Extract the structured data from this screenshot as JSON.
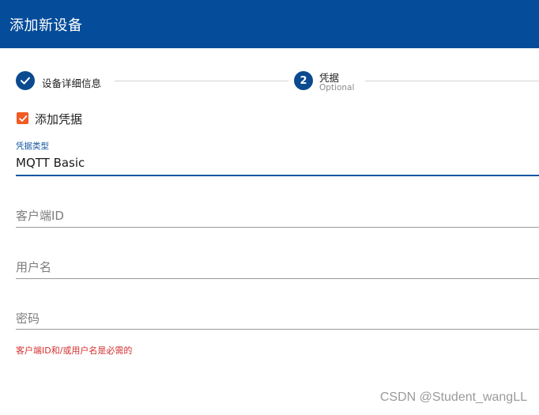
{
  "header": {
    "title": "添加新设备"
  },
  "stepper": {
    "steps": [
      {
        "label": "设备详细信息",
        "state": "completed"
      },
      {
        "number": "2",
        "label": "凭据",
        "sublabel": "Optional",
        "state": "active"
      }
    ]
  },
  "credentials": {
    "add_checkbox_label": "添加凭据",
    "add_checkbox_checked": true,
    "type_label": "凭据类型",
    "type_value": "MQTT Basic",
    "client_id_placeholder": "客户端ID",
    "username_placeholder": "用户名",
    "password_placeholder": "密码",
    "error_message": "客户端ID和/或用户名是必需的"
  },
  "watermark": "CSDN @Student_wangLL",
  "colors": {
    "header_bg": "#054c9a",
    "step_circle": "#0b4a8f",
    "checkbox": "#f15a22",
    "focus_underline": "#1457a0",
    "error": "#d32f2f"
  }
}
